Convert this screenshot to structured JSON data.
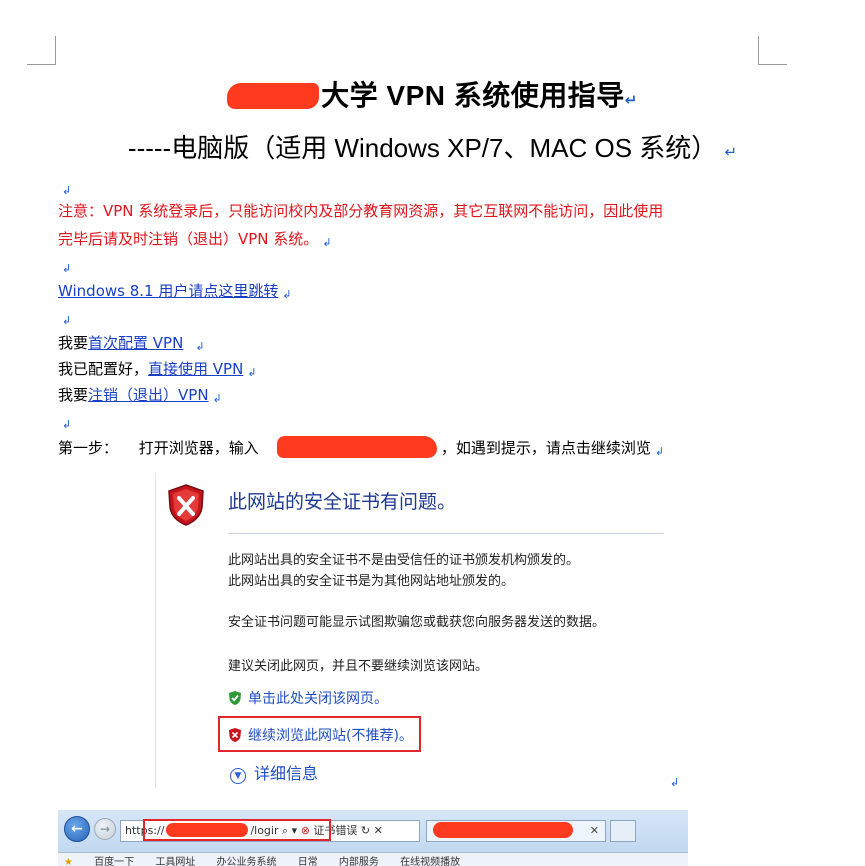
{
  "document": {
    "title": "大学 VPN 系统使用指导",
    "subtitle": "-----电脑版（适用 Windows XP/7、MAC OS 系统）",
    "notice": [
      "注意：VPN 系统登录后，只能访问校内及部分教育网资源，其它互联网不能访问，因此使用",
      "完毕后请及时注销（退出）VPN 系统。"
    ],
    "win81_link": "Windows 8.1 用户请点这里跳转",
    "links": {
      "first_prefix": "我要",
      "first_link": "首次配置 VPN",
      "direct_prefix": "我已配置好，",
      "direct_link": "直接使用 VPN",
      "logout_prefix": "我要",
      "logout_link": "注销（退出）VPN"
    },
    "step1": {
      "label": "第一步：",
      "text_before": "打开浏览器，输入",
      "text_after": "，如遇到提示，请点击继续浏览"
    }
  },
  "cert_page": {
    "heading": "此网站的安全证书有问题。",
    "line1": "此网站出具的安全证书不是由受信任的证书颁发机构颁发的。",
    "line2": "此网站出具的安全证书是为其他网站地址颁发的。",
    "line3": "安全证书问题可能显示试图欺骗您或截获您向服务器发送的数据。",
    "line4": "建议关闭此网页，并且不要继续浏览该网站。",
    "close_option": "单击此处关闭该网页。",
    "continue_option": "继续浏览此网站(不推荐)。",
    "more_info": "详细信息"
  },
  "browser": {
    "url_prefix": "https://",
    "url_suffix": "/logir",
    "cert_error": "证书错误",
    "favorites": [
      "百度一下",
      "工具网址",
      "办公业务系统",
      "日常",
      "内部服务",
      "在线视频播放"
    ]
  },
  "colors": {
    "notice": "#e0151b",
    "link": "#1a3fc7",
    "redaction": "#ff3b1f",
    "highlight_box": "#e3262b"
  }
}
